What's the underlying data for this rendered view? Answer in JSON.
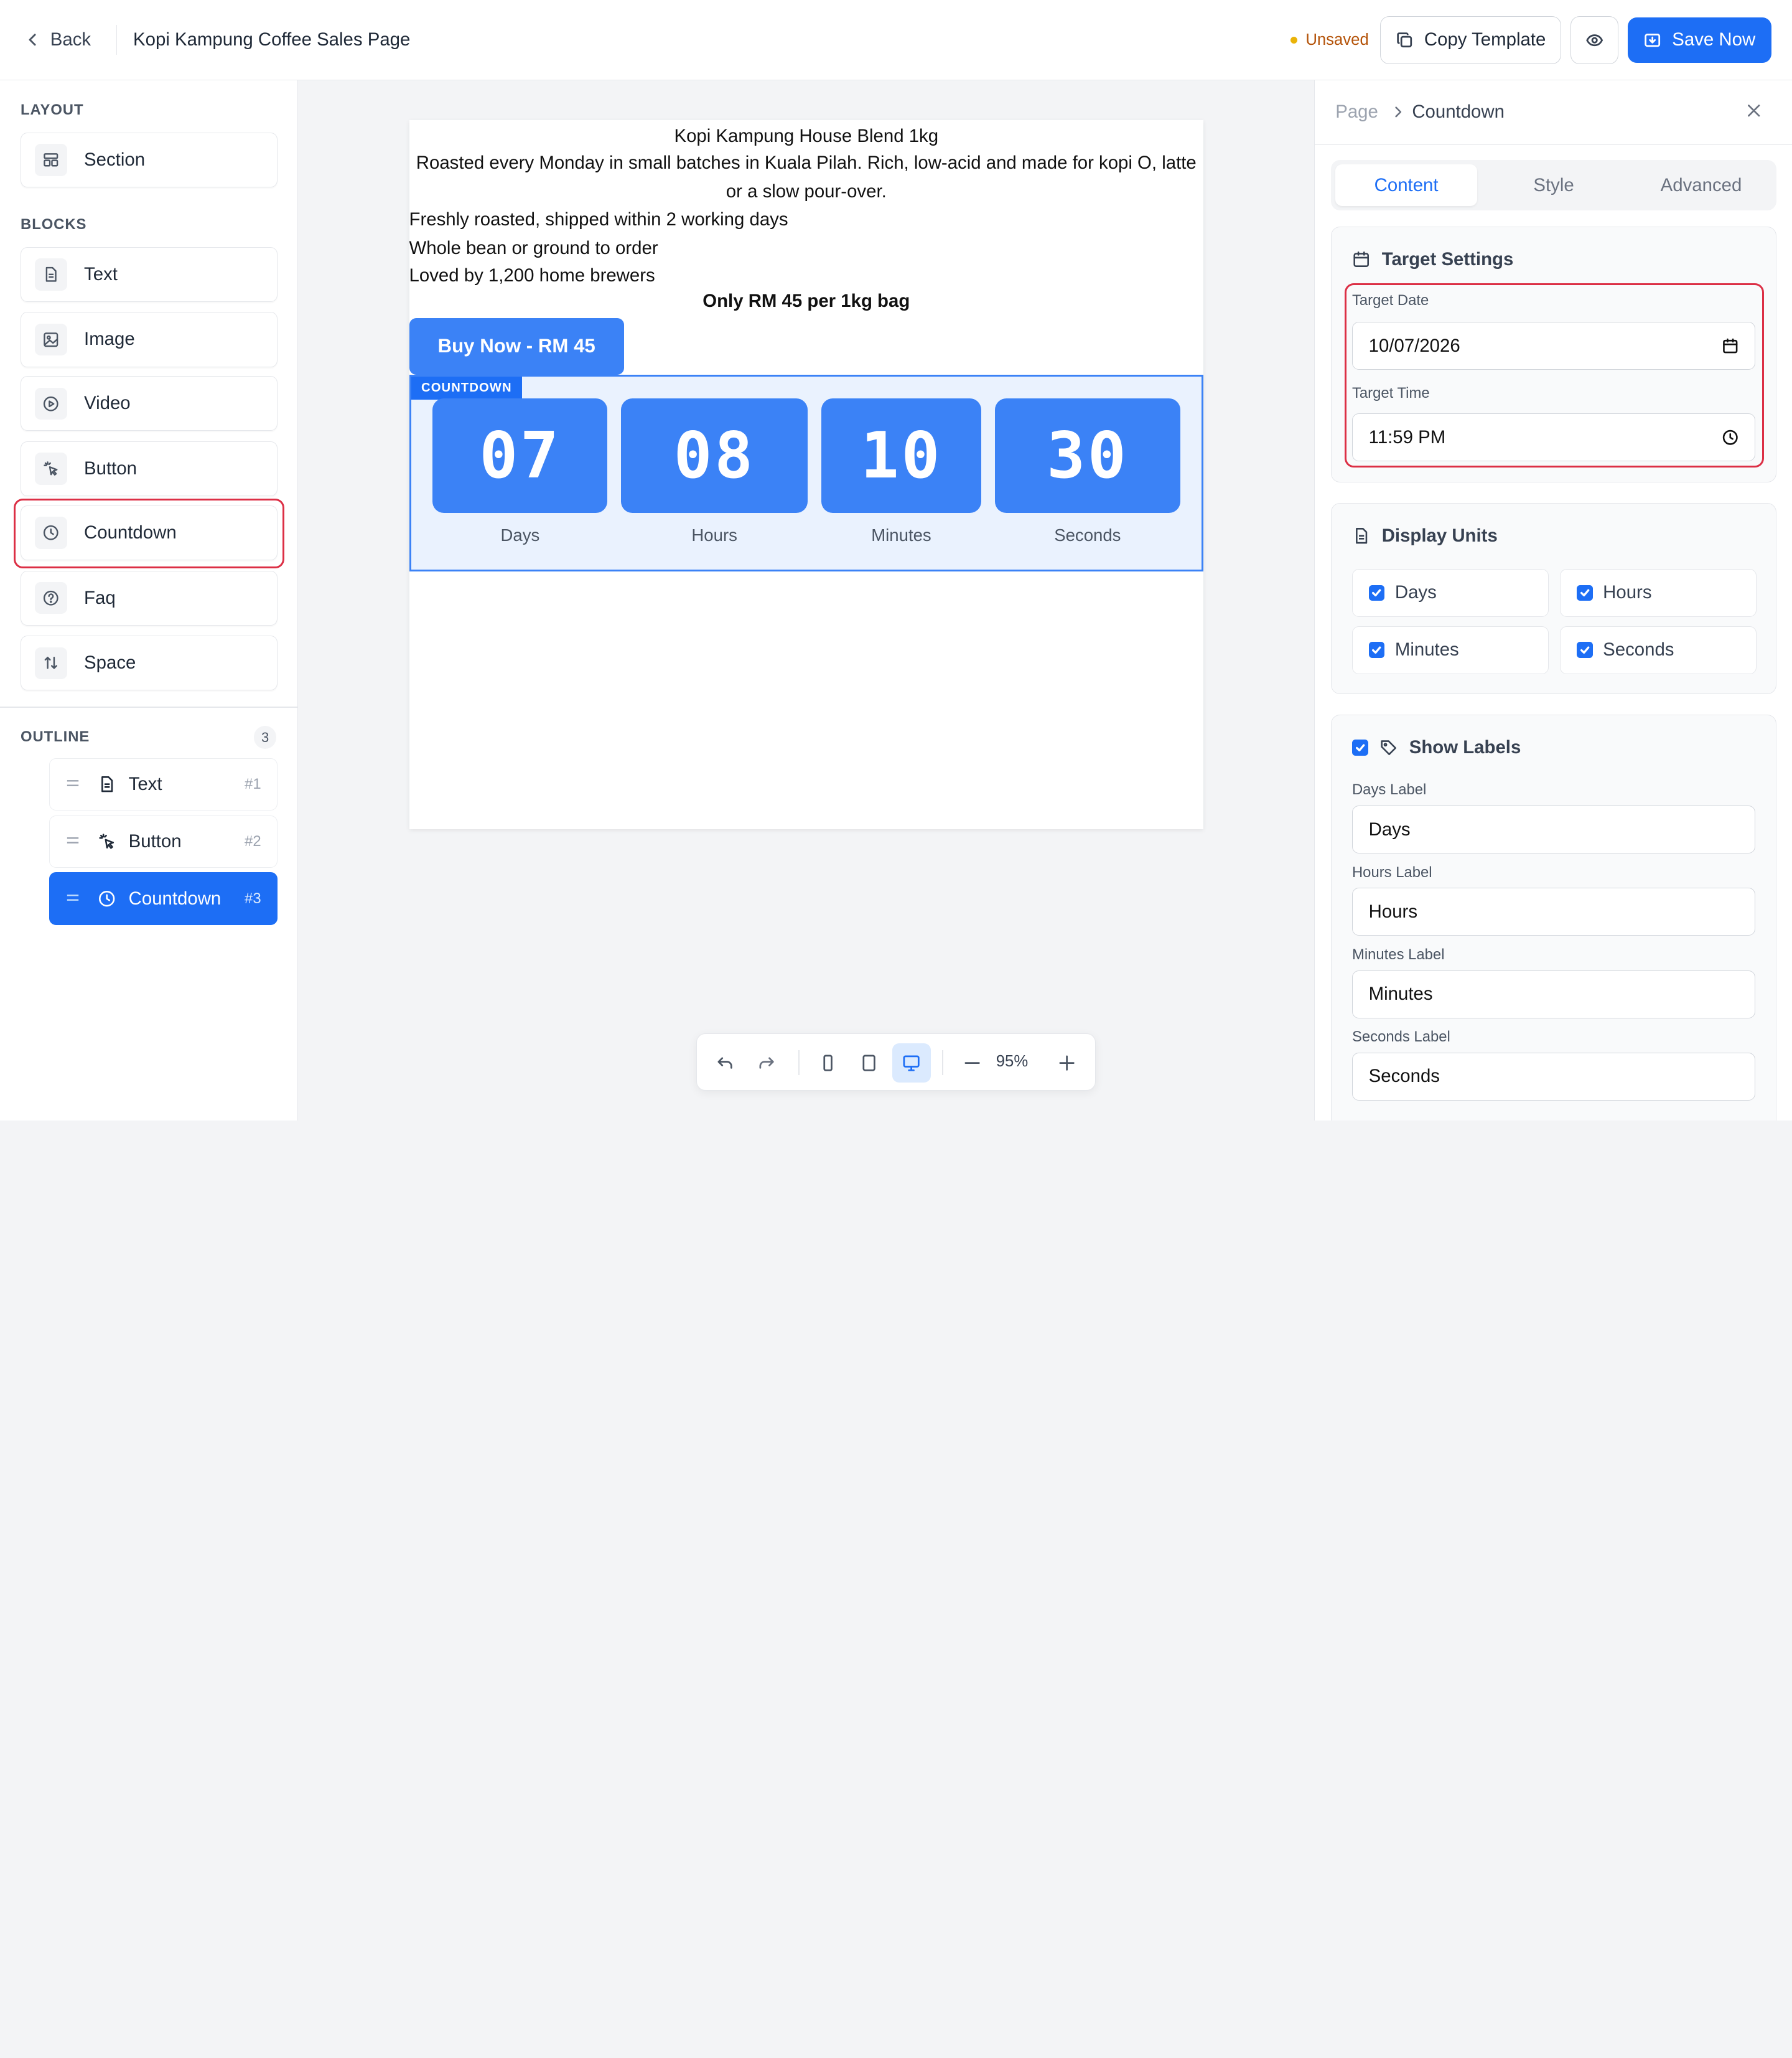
{
  "header": {
    "back_label": "Back",
    "page_name": "Kopi Kampung Coffee Sales Page",
    "status": "Unsaved",
    "copy_template_label": "Copy Template",
    "save_label": "Save Now"
  },
  "sidebar": {
    "layout_title": "LAYOUT",
    "layout_items": [
      {
        "label": "Section",
        "icon": "layout-icon"
      }
    ],
    "blocks_title": "BLOCKS",
    "block_items": [
      {
        "label": "Text",
        "icon": "file-text-icon"
      },
      {
        "label": "Image",
        "icon": "image-icon"
      },
      {
        "label": "Video",
        "icon": "play-circle-icon"
      },
      {
        "label": "Button",
        "icon": "pointer-click-icon"
      },
      {
        "label": "Countdown",
        "icon": "clock-icon"
      },
      {
        "label": "Faq",
        "icon": "help-circle-icon"
      },
      {
        "label": "Space",
        "icon": "arrows-vertical-icon"
      }
    ],
    "outline_title": "OUTLINE",
    "outline_count": "3",
    "outline_items": [
      {
        "label": "Text",
        "num": "#1",
        "icon": "file-text-icon"
      },
      {
        "label": "Button",
        "num": "#2",
        "icon": "pointer-click-icon"
      },
      {
        "label": "Countdown",
        "num": "#3",
        "icon": "clock-icon",
        "active": true
      }
    ]
  },
  "canvas": {
    "title": "Kopi Kampung House Blend 1kg",
    "description": "Roasted every Monday in small batches in Kuala Pilah. Rich, low-acid and made for kopi O, latte or a slow pour-over.",
    "features": [
      "Freshly roasted, shipped within 2 working days",
      "Whole bean or ground to order",
      "Loved by 1,200 home brewers"
    ],
    "price": "Only RM 45 per 1kg bag",
    "buy_button": "Buy Now - RM 45",
    "countdown_tag": "COUNTDOWN",
    "countdown": [
      {
        "value": "07",
        "label": "Days"
      },
      {
        "value": "08",
        "label": "Hours"
      },
      {
        "value": "10",
        "label": "Minutes"
      },
      {
        "value": "30",
        "label": "Seconds"
      }
    ]
  },
  "toolbar": {
    "zoom": "95%",
    "icons": [
      "undo-icon",
      "redo-icon",
      "mobile-icon",
      "tablet-icon",
      "desktop-icon",
      "zoom-out-icon",
      "zoom-in-icon"
    ]
  },
  "panel": {
    "breadcrumb_root": "Page",
    "breadcrumb_current": "Countdown",
    "tabs": [
      "Content",
      "Style",
      "Advanced"
    ],
    "active_tab": "Content",
    "target": {
      "title": "Target Settings",
      "date_label": "Target Date",
      "date_value": "10/07/2026",
      "time_label": "Target Time",
      "time_value": "11:59 PM"
    },
    "units": {
      "title": "Display Units",
      "options": [
        {
          "label": "Days",
          "checked": true
        },
        {
          "label": "Hours",
          "checked": true
        },
        {
          "label": "Minutes",
          "checked": true
        },
        {
          "label": "Seconds",
          "checked": true
        }
      ]
    },
    "labels": {
      "title": "Show Labels",
      "checked": true,
      "fields": [
        {
          "label": "Days Label",
          "value": "Days"
        },
        {
          "label": "Hours Label",
          "value": "Hours"
        },
        {
          "label": "Minutes Label",
          "value": "Minutes"
        },
        {
          "label": "Seconds Label",
          "value": "Seconds"
        }
      ]
    }
  },
  "colors": {
    "accent": "#1d6ef5",
    "countdown_box": "#3b82f6",
    "highlight": "#dc2f45",
    "unsaved": "#b45309"
  }
}
